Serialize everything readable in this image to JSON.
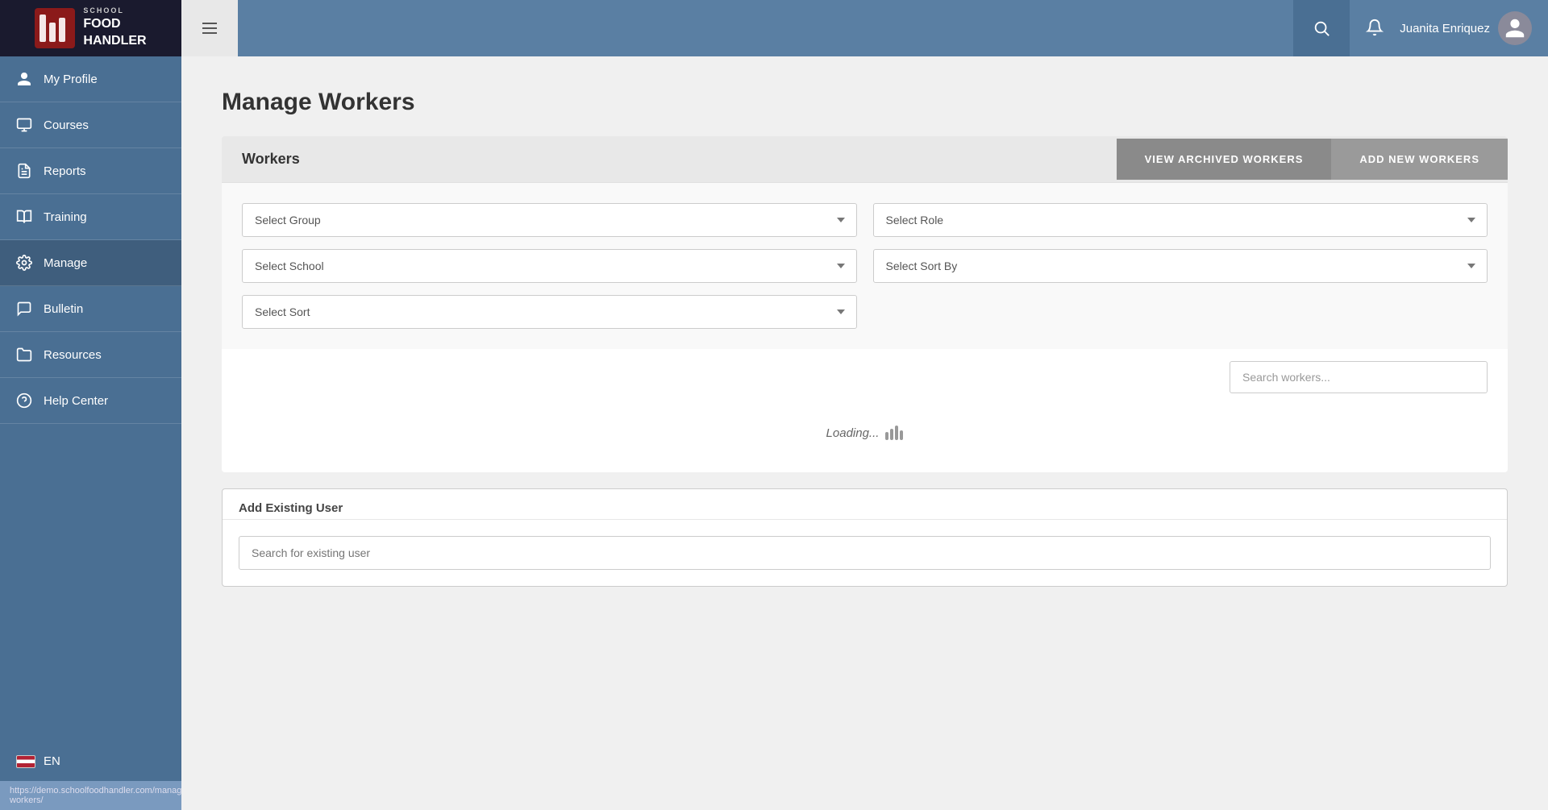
{
  "app": {
    "name": "School Food Handler",
    "logo_sub": "SCHOOL",
    "logo_main1": "FOOD",
    "logo_main2": "HANDLER"
  },
  "header": {
    "user_name": "Juanita Enriquez",
    "search_aria": "Search"
  },
  "sidebar": {
    "items": [
      {
        "label": "My Profile",
        "icon": "user-icon"
      },
      {
        "label": "Courses",
        "icon": "courses-icon"
      },
      {
        "label": "Reports",
        "icon": "reports-icon"
      },
      {
        "label": "Training",
        "icon": "training-icon"
      },
      {
        "label": "Manage",
        "icon": "manage-icon",
        "active": true
      },
      {
        "label": "Bulletin",
        "icon": "bulletin-icon"
      },
      {
        "label": "Resources",
        "icon": "resources-icon"
      },
      {
        "label": "Help Center",
        "icon": "help-icon"
      }
    ],
    "lang": "EN"
  },
  "page": {
    "title": "Manage Workers"
  },
  "workers_section": {
    "label": "Workers",
    "view_archived_btn": "VIEW ARCHIVED WORKERS",
    "add_new_btn": "ADD NEW WORKERS"
  },
  "filters": {
    "group": {
      "placeholder": "Select Group"
    },
    "role": {
      "placeholder": "Select Role"
    },
    "school": {
      "placeholder": "Select School"
    },
    "sort_by": {
      "placeholder": "Select Sort By"
    },
    "sort": {
      "placeholder": "Select Sort"
    }
  },
  "search": {
    "placeholder": "Search workers..."
  },
  "loading": {
    "text": "Loading..."
  },
  "add_existing": {
    "legend": "Add Existing User",
    "placeholder": "Search for existing user"
  },
  "url_bar": {
    "text": "https://demo.schoolfoodhandler.com/manage/manage-workers/"
  }
}
